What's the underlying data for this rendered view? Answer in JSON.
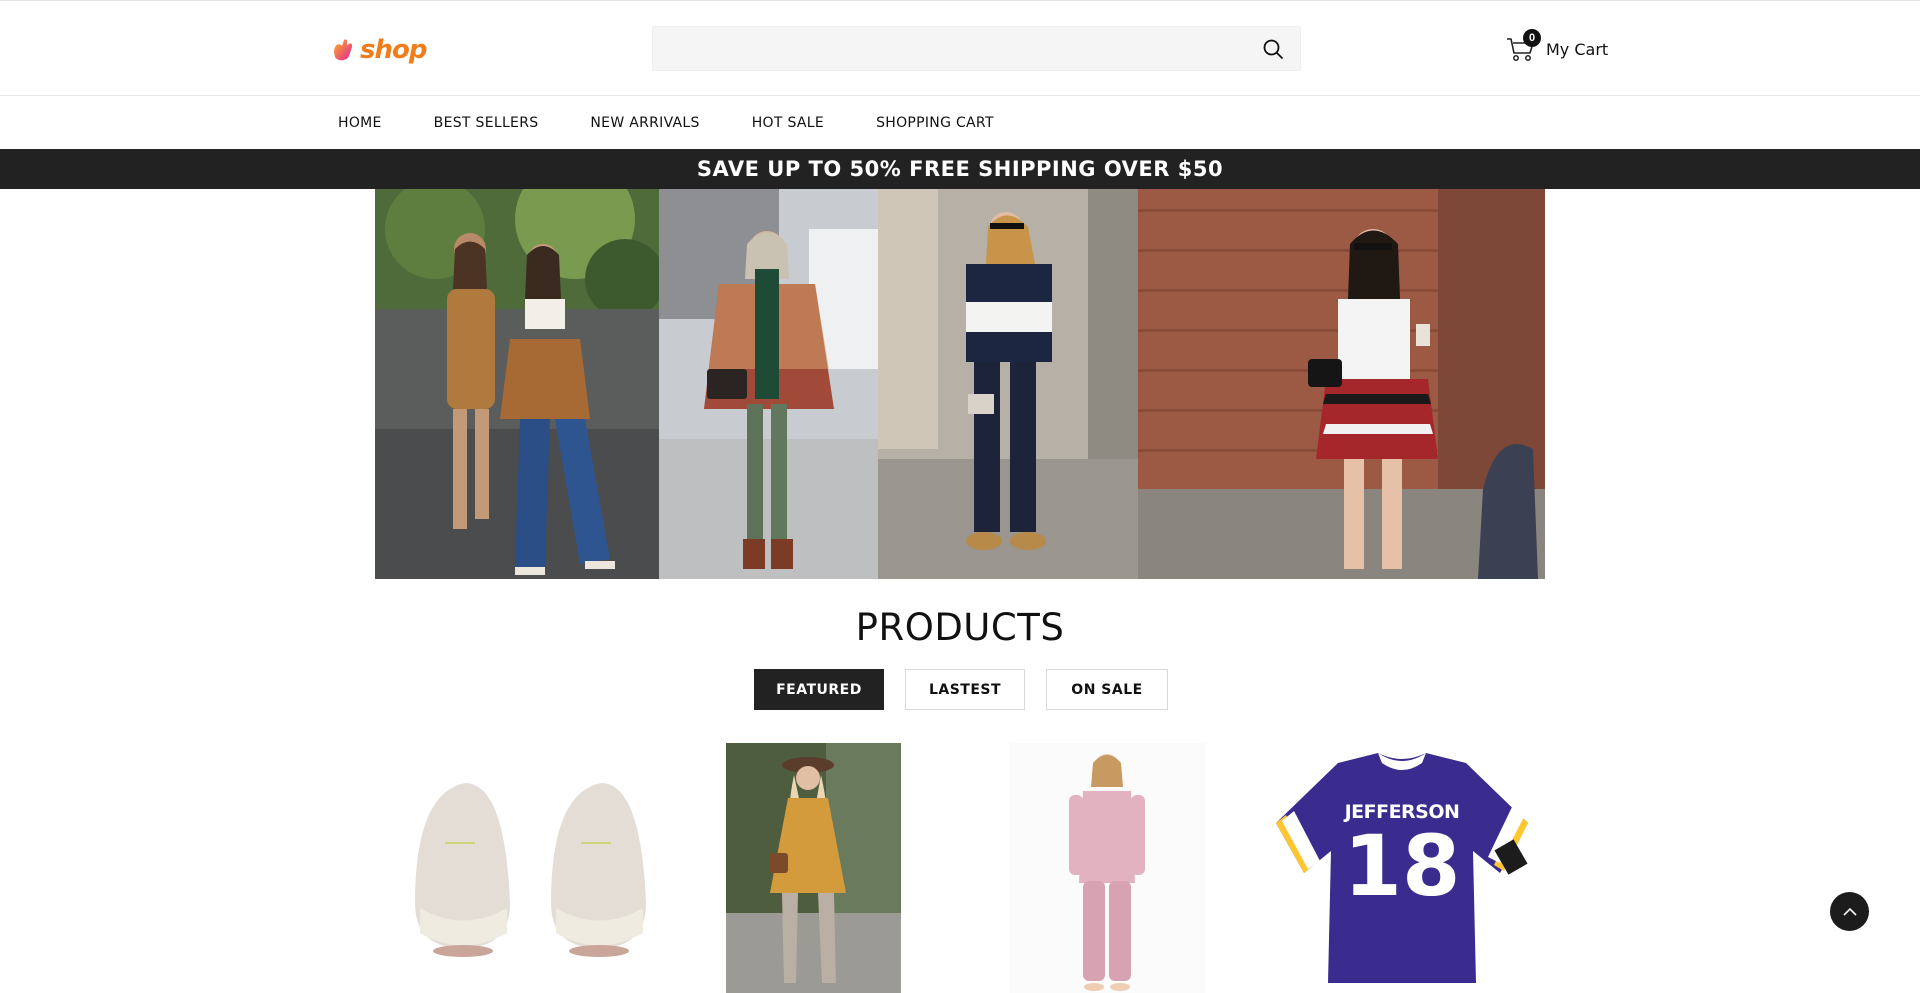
{
  "brand": {
    "name": "shop",
    "accent": "#f07c1a"
  },
  "search": {
    "placeholder": "",
    "value": "",
    "icon": "search-icon"
  },
  "cart": {
    "count": "0",
    "label": "My Cart",
    "icon": "cart-icon"
  },
  "nav": {
    "items": [
      {
        "label": "HOME"
      },
      {
        "label": "BEST SELLERS"
      },
      {
        "label": "NEW ARRIVALS"
      },
      {
        "label": "HOT SALE"
      },
      {
        "label": "SHOPPING CART"
      }
    ]
  },
  "promo": {
    "text": "SAVE UP TO 50% FREE SHIPPING OVER $50",
    "background": "#222222"
  },
  "products": {
    "title": "PRODUCTS",
    "tabs": [
      {
        "label": "FEATURED",
        "active": true
      },
      {
        "label": "LASTEST",
        "active": false
      },
      {
        "label": "ON SALE",
        "active": false
      }
    ],
    "items": [
      {
        "image": "sneakers-photo"
      },
      {
        "image": "mustard-dress-photo"
      },
      {
        "image": "pink-pajamas-photo"
      },
      {
        "image": "jersey-photo",
        "jersey_name": "JEFFERSON",
        "jersey_number": "18"
      }
    ]
  },
  "back_to_top": {
    "icon": "chevron-up-icon"
  }
}
